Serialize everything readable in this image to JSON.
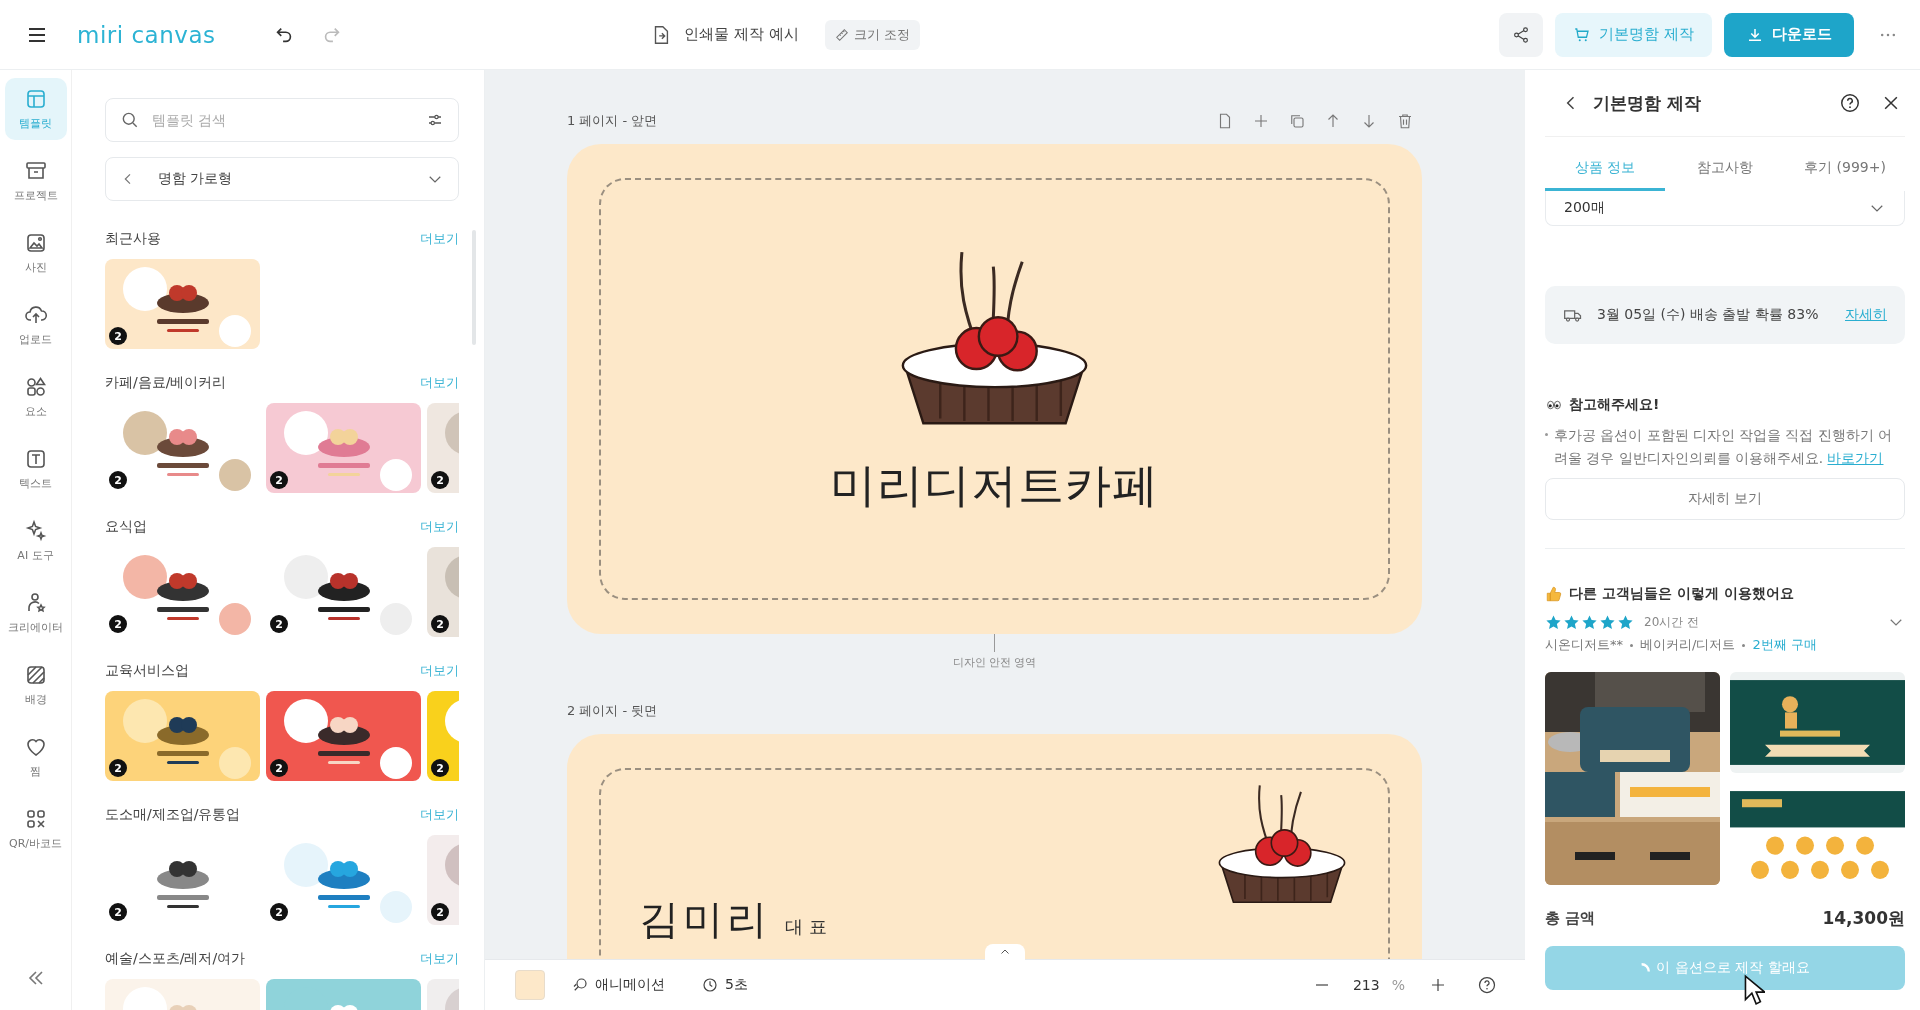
{
  "top_bar": {
    "logo": "miri canvas",
    "undo_disabled": false,
    "redo_disabled": true,
    "document_title": "인쇄물 제작 예시",
    "resize_button": "크기 조정",
    "order_button": "기본명함 제작",
    "download_button": "다운로드"
  },
  "rail": {
    "items": [
      {
        "label": "템플릿",
        "selected": true
      },
      {
        "label": "프로젝트",
        "selected": false
      },
      {
        "label": "사진",
        "selected": false
      },
      {
        "label": "업로드",
        "selected": false
      },
      {
        "label": "요소",
        "selected": false
      },
      {
        "label": "텍스트",
        "selected": false
      },
      {
        "label": "AI 도구",
        "selected": false
      },
      {
        "label": "크리에이터",
        "selected": false
      },
      {
        "label": "배경",
        "selected": false
      },
      {
        "label": "찜",
        "selected": false
      },
      {
        "label": "QR/바코드",
        "selected": false
      }
    ]
  },
  "template_panel": {
    "search": {
      "placeholder": "템플릿 검색"
    },
    "category": "명함 가로형",
    "sections": [
      {
        "title": "최근사용",
        "more_link": "더보기",
        "templates": [
          {
            "kind": "picture",
            "badge": "2"
          }
        ]
      },
      {
        "title": "카페/음료/베이커리",
        "more_link": "더보기",
        "templates": [
          {
            "kind": "picture",
            "badge": "2"
          },
          {
            "kind": "picture",
            "badge": "2"
          },
          {
            "kind": "picture",
            "badge": "2"
          }
        ]
      },
      {
        "title": "요식업",
        "more_link": "더보기",
        "templates": [
          {
            "kind": "picture",
            "badge": "2"
          },
          {
            "kind": "picture",
            "badge": "2"
          },
          {
            "kind": "picture",
            "badge": "2"
          }
        ]
      },
      {
        "title": "교육서비스업",
        "more_link": "더보기",
        "templates": [
          {
            "kind": "picture",
            "badge": "2"
          },
          {
            "kind": "picture",
            "badge": "2"
          },
          {
            "kind": "picture",
            "badge": "2"
          }
        ]
      },
      {
        "title": "도소매/제조업/유통업",
        "more_link": "더보기",
        "templates": [
          {
            "kind": "picture",
            "badge": "2"
          },
          {
            "kind": "picture",
            "badge": "2"
          },
          {
            "kind": "picture",
            "badge": "2"
          }
        ]
      },
      {
        "title": "예술/스포츠/레저/여가",
        "more_link": "더보기"
      }
    ]
  },
  "canvas": {
    "pages": [
      {
        "kind": "front",
        "label": "1 페이지 - 앞면",
        "title": "미리디저트카페"
      },
      {
        "kind": "back",
        "label": "2 페이지 - 뒷면",
        "name": "김미리",
        "role": "대 표"
      }
    ],
    "safe_area_label": "디자인 안전 영역"
  },
  "bottom_bar": {
    "animation_button": "애니메이션",
    "duration": "5초",
    "zoom": "213",
    "zoom_unit": "%"
  },
  "product_panel": {
    "title": "기본명함 제작",
    "tabs": [
      {
        "label": "상품 정보",
        "selected": true
      },
      {
        "label": "참고사항",
        "selected": false
      },
      {
        "label": "후기 (999+)",
        "selected": false
      }
    ],
    "quantity": "200매",
    "delivery": "3월 05일 (수) 배송 출발 확률 83%",
    "delivery_link": "자세히",
    "notice_title": "참고해주세요!",
    "notice_text": "후가공 옵션이 포함된 디자인 작업을 직접 진행하기 어려울 경우 일반디자인의뢰를 이용해주세요.",
    "notice_link": "바로가기",
    "detail_button": "자세히 보기",
    "review_heading": "다른 고객님들은 이렇게 이용했어요",
    "review": {
      "stars": 5,
      "time": "20시간 전",
      "author": "시온디저트**",
      "category": "베이커리/디저트",
      "purchase": "2번째 구매"
    },
    "total_label": "총 금액",
    "total": "14,300원",
    "submit_button": "이 옵션으로 제작 할래요",
    "submit_loading": true
  }
}
